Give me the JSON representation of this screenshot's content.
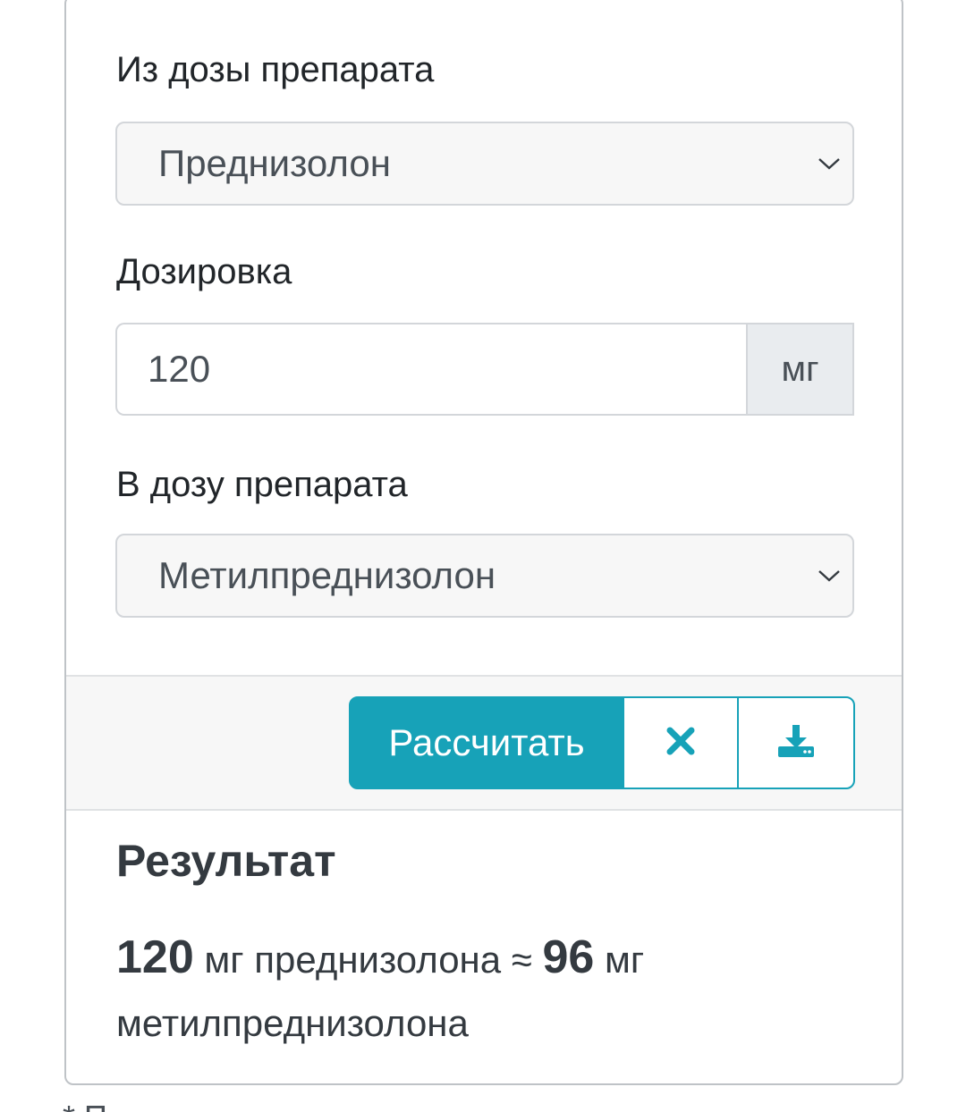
{
  "form": {
    "from_label": "Из дозы препарата",
    "from_value": "Преднизолон",
    "dose_label": "Дозировка",
    "dose_value": "120",
    "dose_unit": "мг",
    "to_label": "В дозу препарата",
    "to_value": "Метилпреднизолон"
  },
  "actions": {
    "calculate_label": "Рассчитать",
    "clear_icon": "close-icon",
    "download_icon": "download-icon"
  },
  "result": {
    "title": "Результат",
    "from_amount": "120",
    "from_text": " мг преднизолона ≈ ",
    "to_amount": "96",
    "to_text": " мг метилпреднизолона"
  },
  "footnote": "* П",
  "colors": {
    "accent": "#17a2b8",
    "select_bg": "#f7f7f7",
    "addon_bg": "#e9ecef",
    "border": "#d3d6da"
  }
}
